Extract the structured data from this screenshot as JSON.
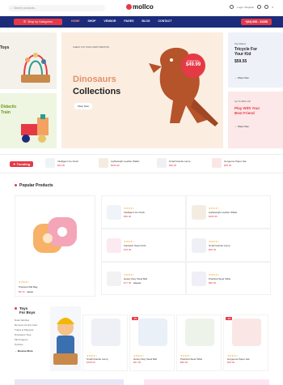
{
  "header": {
    "search_placeholder": "Search products...",
    "logo": "mollco",
    "account_label": "Login / Register",
    "cart_count": "0"
  },
  "nav": {
    "categories_label": "Shop by Categories",
    "links": [
      "HOME",
      "SHOP",
      "VENDOR",
      "PAGES",
      "BLOG",
      "CONTACT"
    ],
    "phone": "+(84) 658 - 33288"
  },
  "banners": {
    "left_top": {
      "title": "Toys"
    },
    "left_bottom": {
      "title_line1": "Didactic",
      "title_line2": "Train"
    },
    "hero": {
      "kicker": "CHECK OUT OUR LATEST ADDITION",
      "title_line1": "Dinosaurs",
      "title_line2": "Collections",
      "button": "Shop Now",
      "price_tag_label": "Original Price",
      "price": "$49.99"
    },
    "right_top": {
      "kicker": "Top Rated",
      "title_line1": "Tricycle For",
      "title_line2": "Your Kid",
      "price": "$59.55",
      "button": "Shop Now"
    },
    "right_bottom": {
      "kicker": "Up To 50% Off",
      "title_line1": "Play With Your",
      "title_line2": "Best Friend",
      "button": "Shop Now"
    }
  },
  "trending": {
    "label": "Trending",
    "items": [
      {
        "name": "Intelligent Ice Clock",
        "price": "$29.00"
      },
      {
        "name": "Lightweight Leather Wallet",
        "price": "$266.99"
      },
      {
        "name": "Small Granite Lamp",
        "price": "$99.00"
      },
      {
        "name": "Gorgeous Paper Hat",
        "price": "$58.00"
      }
    ]
  },
  "popular": {
    "title": "Popular Products",
    "featured": {
      "rating": "★★★★☆",
      "name": "Practical Silk Bag",
      "price": "$6.29",
      "old_price": "$8.49"
    },
    "items": [
      {
        "name": "Intelligent Ice Clock",
        "price": "$69.00",
        "rating": "★★★★☆"
      },
      {
        "name": "Lightweight Leather Wallet",
        "price": "$266.99",
        "rating": "★★★★☆"
      },
      {
        "name": "Fantastic Steel Knife",
        "price": "$78.00",
        "rating": "★★★★☆"
      },
      {
        "name": "Small Granite Lamp",
        "price": "$99.00",
        "rating": "★★★★☆"
      },
      {
        "name": "Heavy Duty Steel Bell",
        "price": "$77.00",
        "old_price": "$89.00",
        "rating": "★★★★☆"
      },
      {
        "name": "Practical Steel Table",
        "price": "$86.00",
        "rating": "★★★★☆"
      }
    ]
  },
  "toys_section": {
    "title_line1": "Toys",
    "title_line2": "For Boys",
    "links": [
      "Dual Vehicles",
      "Remote Control Cars",
      "Trains & Playsets",
      "Dinosaurs Toys",
      "Mini Figures",
      "Puzzles"
    ],
    "browse": "Browse More",
    "cards": [
      {
        "badge": "",
        "name": "Small Granite Lamp",
        "price": "$158.00"
      },
      {
        "badge": "-9%",
        "name": "Heavy Duty Steel Bell",
        "price": "$67.00"
      },
      {
        "badge": "",
        "name": "Practical Steel Table",
        "price": "$86.00"
      },
      {
        "badge": "-8%",
        "name": "Gorgeous Paper Hat",
        "price": "$48.00"
      }
    ]
  }
}
